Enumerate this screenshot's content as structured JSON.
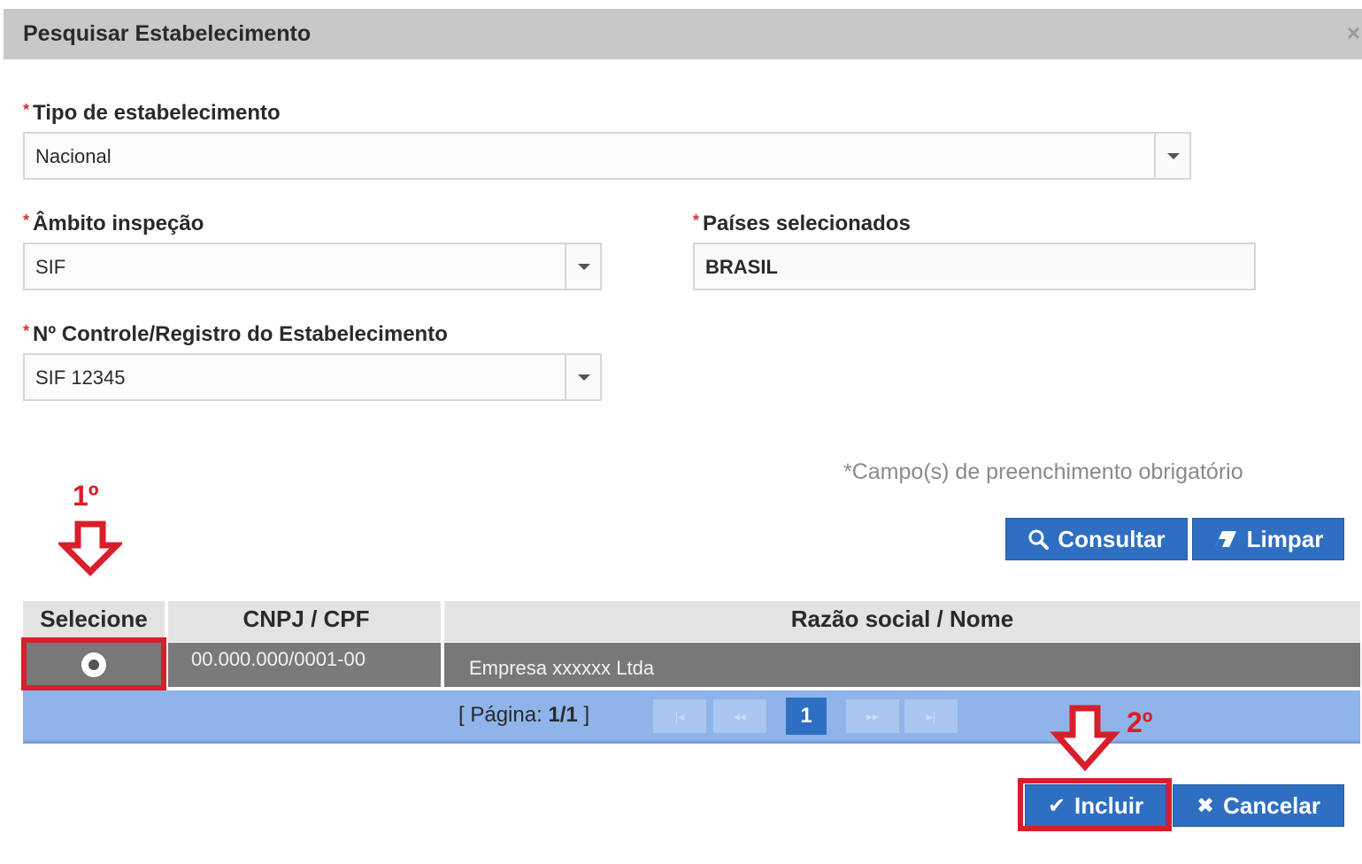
{
  "dialog": {
    "title": "Pesquisar Estabelecimento",
    "close_glyph": "×"
  },
  "form": {
    "required_mark": "*",
    "tipo": {
      "label": "Tipo de estabelecimento",
      "value": "Nacional"
    },
    "ambito": {
      "label": "Âmbito inspeção",
      "value": "SIF"
    },
    "paises": {
      "label": "Países selecionados",
      "value": "BRASIL"
    },
    "controle": {
      "label": "Nº Controle/Registro do Estabelecimento",
      "value": "SIF 12345"
    },
    "required_note": "*Campo(s) de preenchimento obrigatório"
  },
  "actions": {
    "consultar": "Consultar",
    "limpar": "Limpar",
    "incluir": "Incluir",
    "cancelar": "Cancelar"
  },
  "table": {
    "headers": [
      "Selecione",
      "CNPJ / CPF",
      "Razão social / Nome"
    ],
    "rows": [
      {
        "cnpj": "00.000.000/0001-00",
        "razao": "Empresa xxxxxx Ltda"
      }
    ]
  },
  "pager": {
    "label": "[ Página: ",
    "value": "1/1",
    "close": " ]",
    "current": "1",
    "first": "|◂",
    "prev": "◂◂",
    "next": "▸▸",
    "last": "▸|"
  },
  "annotations": {
    "step1": "1º",
    "step2": "2º"
  },
  "colors": {
    "primary": "#2f6fc2",
    "highlight": "#d81e2a",
    "pager": "#8fb4ea"
  }
}
